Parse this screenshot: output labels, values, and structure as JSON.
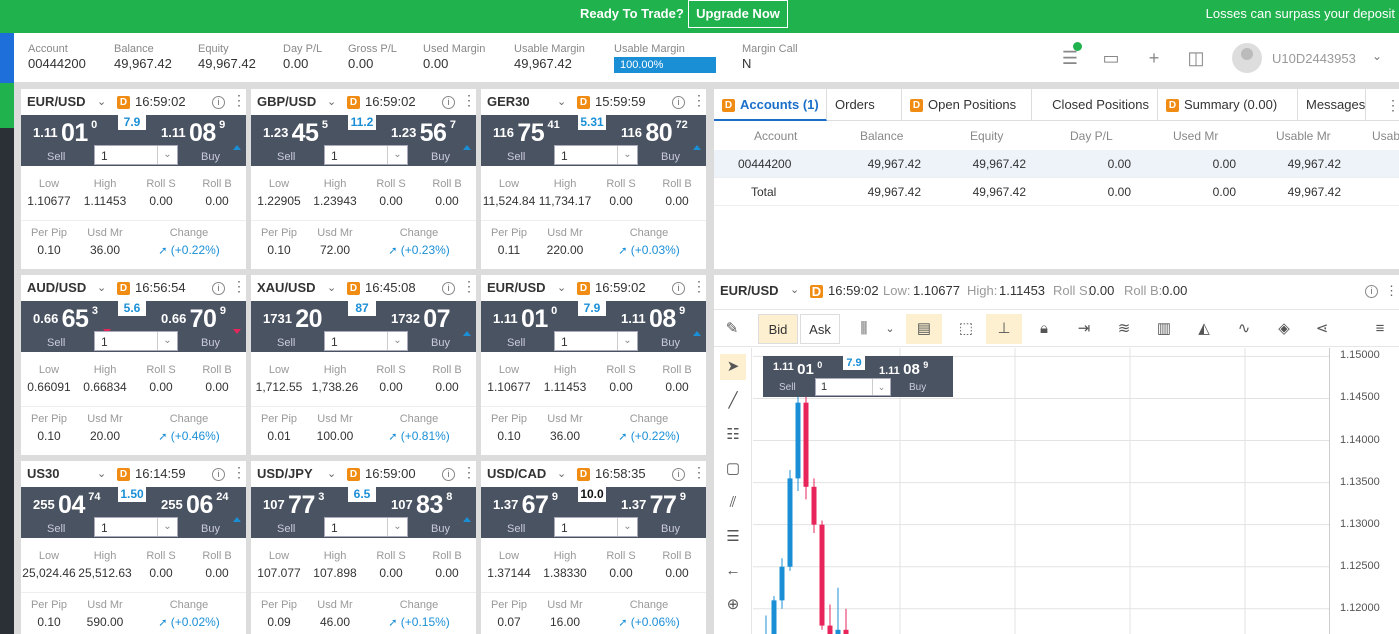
{
  "topbar": {
    "ready": "Ready To Trade?",
    "upgrade": "Upgrade Now",
    "warning": "Losses can surpass your deposit"
  },
  "account": {
    "items": [
      {
        "label": "Account",
        "value": "00444200"
      },
      {
        "label": "Balance",
        "value": "49,967.42"
      },
      {
        "label": "Equity",
        "value": "49,967.42"
      },
      {
        "label": "Day P/L",
        "value": "0.00"
      },
      {
        "label": "Gross P/L",
        "value": "0.00"
      },
      {
        "label": "Used Margin",
        "value": "0.00"
      },
      {
        "label": "Usable Margin",
        "value": "49,967.42"
      },
      {
        "label": "Usable Margin",
        "value": "100.00%"
      },
      {
        "label": "Margin Call",
        "value": "N"
      }
    ],
    "user": "U10D2443953"
  },
  "labels": {
    "sell": "Sell",
    "buy": "Buy",
    "low": "Low",
    "high": "High",
    "rolls": "Roll S",
    "rollb": "Roll B",
    "perpip": "Per Pip",
    "usdmr": "Usd Mr",
    "change": "Change",
    "d": "D"
  },
  "tiles": [
    {
      "sym": "EUR/USD",
      "time": "16:59:02",
      "spread": "7.9",
      "s1": "1.11",
      "s2": "01",
      "s3": "0",
      "b1": "1.11",
      "b2": "08",
      "b3": "9",
      "sdir": "up",
      "bdir": "up",
      "qty": "1",
      "low": "1.10677",
      "high": "1.11453",
      "rolls": "0.00",
      "rollb": "0.00",
      "pip": "0.10",
      "mr": "36.00",
      "chg": "(+0.22%)"
    },
    {
      "sym": "GBP/USD",
      "time": "16:59:02",
      "spread": "11.2",
      "s1": "1.23",
      "s2": "45",
      "s3": "5",
      "b1": "1.23",
      "b2": "56",
      "b3": "7",
      "sdir": "up",
      "bdir": "up",
      "qty": "1",
      "low": "1.22905",
      "high": "1.23943",
      "rolls": "0.00",
      "rollb": "0.00",
      "pip": "0.10",
      "mr": "72.00",
      "chg": "(+0.23%)"
    },
    {
      "sym": "GER30",
      "time": "15:59:59",
      "spread": "5.31",
      "s1": "116",
      "s2": "75",
      "s3": "41",
      "b1": "116",
      "b2": "80",
      "b3": "72",
      "sdir": "up",
      "bdir": "up",
      "qty": "1",
      "low": "11,524.84",
      "high": "11,734.17",
      "rolls": "0.00",
      "rollb": "0.00",
      "pip": "0.11",
      "mr": "220.00",
      "chg": "(+0.03%)"
    },
    {
      "sym": "AUD/USD",
      "time": "16:56:54",
      "spread": "5.6",
      "s1": "0.66",
      "s2": "65",
      "s3": "3",
      "b1": "0.66",
      "b2": "70",
      "b3": "9",
      "sdir": "down",
      "bdir": "down",
      "qty": "1",
      "low": "0.66091",
      "high": "0.66834",
      "rolls": "0.00",
      "rollb": "0.00",
      "pip": "0.10",
      "mr": "20.00",
      "chg": "(+0.46%)"
    },
    {
      "sym": "XAU/USD",
      "time": "16:45:08",
      "spread": "87",
      "s1": "1731",
      "s2": "20",
      "s3": "",
      "b1": "1732",
      "b2": "07",
      "b3": "",
      "sdir": "up",
      "bdir": "up",
      "qty": "1",
      "low": "1,712.55",
      "high": "1,738.26",
      "rolls": "0.00",
      "rollb": "0.00",
      "pip": "0.01",
      "mr": "100.00",
      "chg": "(+0.81%)"
    },
    {
      "sym": "EUR/USD",
      "time": "16:59:02",
      "spread": "7.9",
      "s1": "1.11",
      "s2": "01",
      "s3": "0",
      "b1": "1.11",
      "b2": "08",
      "b3": "9",
      "sdir": "up",
      "bdir": "up",
      "qty": "1",
      "low": "1.10677",
      "high": "1.11453",
      "rolls": "0.00",
      "rollb": "0.00",
      "pip": "0.10",
      "mr": "36.00",
      "chg": "(+0.22%)"
    },
    {
      "sym": "US30",
      "time": "16:14:59",
      "spread": "1.50",
      "s1": "255",
      "s2": "04",
      "s3": "74",
      "b1": "255",
      "b2": "06",
      "b3": "24",
      "sdir": "up",
      "bdir": "up",
      "qty": "1",
      "low": "25,024.46",
      "high": "25,512.63",
      "rolls": "0.00",
      "rollb": "0.00",
      "pip": "0.10",
      "mr": "590.00",
      "chg": "(+0.02%)"
    },
    {
      "sym": "USD/JPY",
      "time": "16:59:00",
      "spread": "6.5",
      "s1": "107",
      "s2": "77",
      "s3": "3",
      "b1": "107",
      "b2": "83",
      "b3": "8",
      "sdir": "up",
      "bdir": "up",
      "qty": "1",
      "low": "107.077",
      "high": "107.898",
      "rolls": "0.00",
      "rollb": "0.00",
      "pip": "0.09",
      "mr": "46.00",
      "chg": "(+0.15%)"
    },
    {
      "sym": "USD/CAD",
      "time": "16:58:35",
      "spread": "10.0",
      "s1": "1.37",
      "s2": "67",
      "s3": "9",
      "b1": "1.37",
      "b2": "77",
      "b3": "9",
      "sdir": "none",
      "bdir": "none",
      "qty": "1",
      "low": "1.37144",
      "high": "1.38330",
      "rolls": "0.00",
      "rollb": "0.00",
      "pip": "0.07",
      "mr": "16.00",
      "chg": "(+0.06%)"
    }
  ],
  "tabs": [
    {
      "label": "Accounts (1)",
      "d": true,
      "active": true
    },
    {
      "label": "Orders",
      "d": false
    },
    {
      "label": "Open Positions",
      "d": true
    },
    {
      "label": "Closed Positions",
      "d": false
    },
    {
      "label": "Summary (0.00)",
      "d": true
    },
    {
      "label": "Messages",
      "d": false
    }
  ],
  "grid": {
    "headers": [
      "Account",
      "Balance",
      "Equity",
      "Day P/L",
      "Used Mr",
      "Usable Mr",
      "Usab"
    ],
    "rows": [
      [
        "00444200",
        "49,967.42",
        "49,967.42",
        "0.00",
        "0.00",
        "49,967.42"
      ],
      [
        "Total",
        "49,967.42",
        "49,967.42",
        "0.00",
        "0.00",
        "49,967.42"
      ]
    ]
  },
  "chart": {
    "symbol": "EUR/USD",
    "time": "16:59:02",
    "low_label": "Low:",
    "low": "1.10677",
    "high_label": "High:",
    "high": "1.11453",
    "rolls_label": "Roll S:",
    "rolls": "0.00",
    "rollb_label": "Roll B:",
    "rollb": "0.00",
    "bid": "Bid",
    "ask": "Ask",
    "mini": {
      "s1": "1.11",
      "s2": "01",
      "s3": "0",
      "b1": "1.11",
      "b2": "08",
      "b3": "9",
      "spread": "7.9",
      "qty": "1",
      "sell": "Sell",
      "buy": "Buy"
    },
    "yticks": [
      "1.15000",
      "1.14500",
      "1.14000",
      "1.13500",
      "1.13000",
      "1.12500",
      "1.12000"
    ]
  },
  "chart_data": {
    "type": "candlestick",
    "ylim": [
      1.117,
      1.151
    ],
    "yticks": [
      1.15,
      1.145,
      1.14,
      1.135,
      1.13,
      1.125,
      1.12
    ],
    "candles": [
      {
        "o": 1.1165,
        "h": 1.1192,
        "l": 1.116,
        "c": 1.1165
      },
      {
        "o": 1.116,
        "h": 1.1215,
        "l": 1.1155,
        "c": 1.121
      },
      {
        "o": 1.121,
        "h": 1.126,
        "l": 1.12,
        "c": 1.125
      },
      {
        "o": 1.125,
        "h": 1.1365,
        "l": 1.1245,
        "c": 1.1355
      },
      {
        "o": 1.1355,
        "h": 1.146,
        "l": 1.134,
        "c": 1.1445
      },
      {
        "o": 1.1445,
        "h": 1.147,
        "l": 1.133,
        "c": 1.1345
      },
      {
        "o": 1.1345,
        "h": 1.1355,
        "l": 1.129,
        "c": 1.13
      },
      {
        "o": 1.13,
        "h": 1.1305,
        "l": 1.1175,
        "c": 1.118
      },
      {
        "o": 1.118,
        "h": 1.1205,
        "l": 1.115,
        "c": 1.117
      },
      {
        "o": 1.117,
        "h": 1.1225,
        "l": 1.116,
        "c": 1.1175
      },
      {
        "o": 1.1175,
        "h": 1.12,
        "l": 1.115,
        "c": 1.117
      }
    ],
    "colors": {
      "up": "#1b8fd6",
      "down": "#e8255b"
    }
  }
}
